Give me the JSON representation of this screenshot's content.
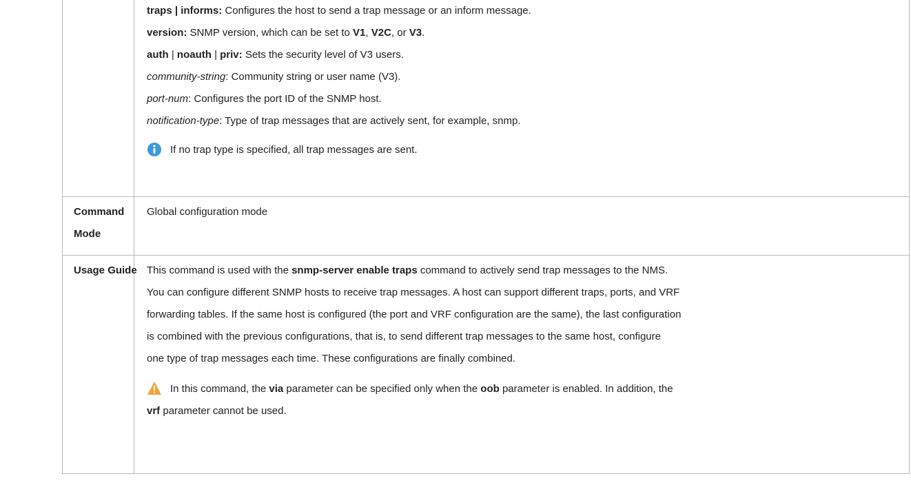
{
  "params": {
    "traps_key": "traps | informs:",
    "traps_desc": " Configures the host to send a trap message or an inform message.",
    "version_key": "version:",
    "version_desc_a": " SNMP version, which can be set to ",
    "v1": "V1",
    "sep1": ", ",
    "v2c": "V2C",
    "sep2": ", or ",
    "v3": "V3",
    "dot": ".",
    "auth": "auth",
    "bar1": " | ",
    "noauth": "noauth",
    "bar2": " | ",
    "priv": "priv:",
    "auth_desc": " Sets the security level of V3 users.",
    "community_key": "community-string",
    "community_desc": ": Community string or user name (V3).",
    "port_key": "port-num",
    "port_desc": ": Configures the port ID of the SNMP host.",
    "notif_key": "notification-type",
    "notif_desc": ": Type of trap messages that are actively sent, for example, snmp.",
    "info_note": "If no trap type is specified, all trap messages are sent."
  },
  "command_mode": {
    "label_1": "Command",
    "label_2": "Mode",
    "value": "Global configuration mode"
  },
  "usage_guide": {
    "label": "Usage Guide",
    "l1_a": "This command is used with the ",
    "l1_b": "snmp-server enable traps",
    "l1_c": " command to actively send trap messages to the NMS.",
    "l2": "You can configure different SNMP hosts to receive trap messages. A host can support different traps, ports, and VRF",
    "l3": "forwarding tables. If the same host is configured (the port and VRF configuration are the same), the last configuration",
    "l4": "is combined with the previous configurations, that is, to send different trap messages to the same host, configure",
    "l5": "one type of trap messages each time. These configurations are finally combined.",
    "w1_a": "In this command, the ",
    "w1_b": "via",
    "w1_c": " parameter can be specified only when the ",
    "w1_d": "oob",
    "w1_e": " parameter is enabled. In addition, the",
    "w2_a": "vrf",
    "w2_b": " parameter cannot be used."
  }
}
